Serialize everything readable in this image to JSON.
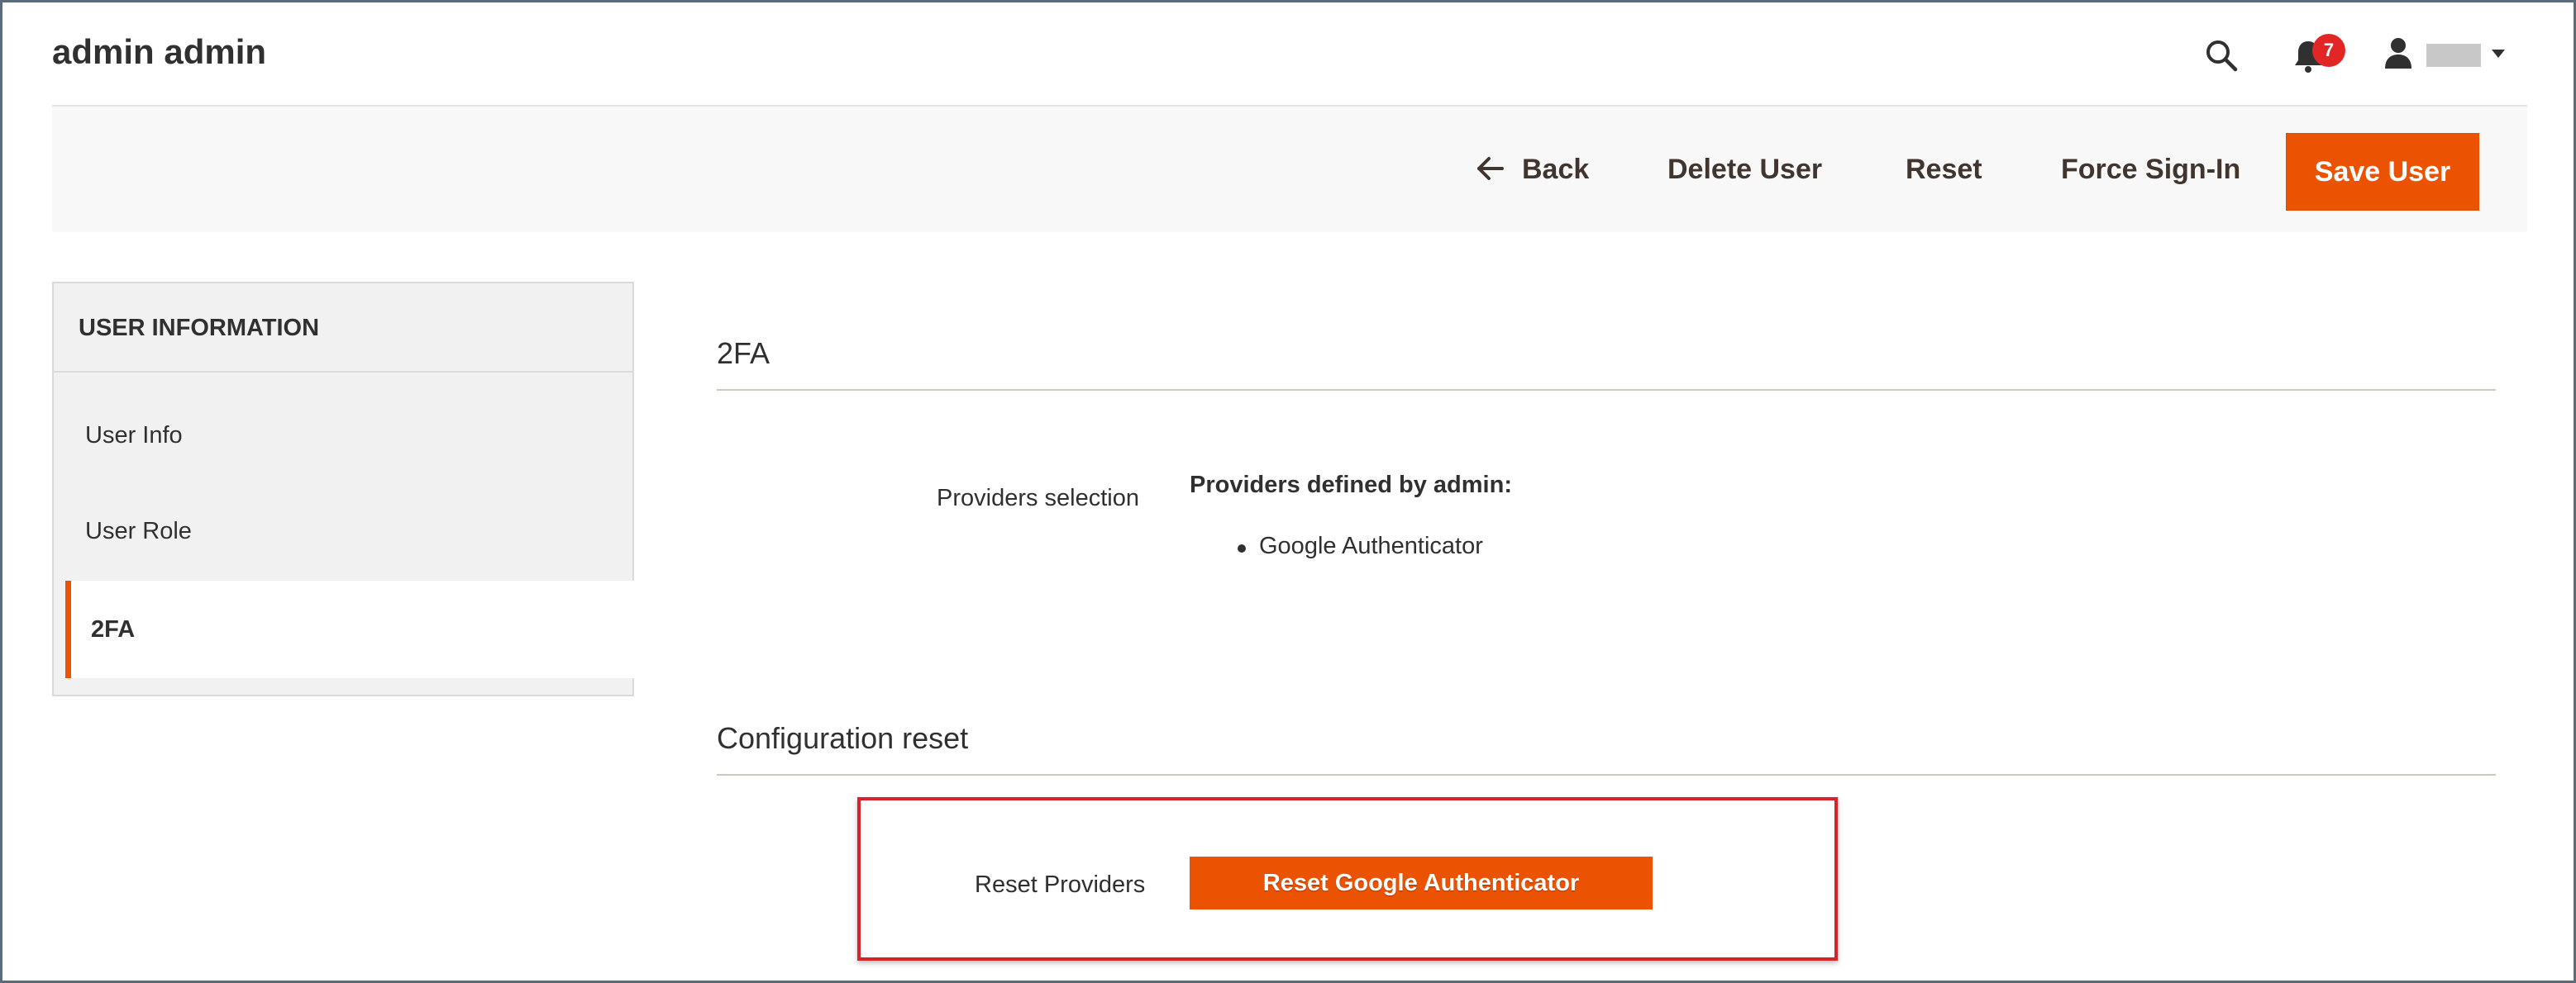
{
  "header": {
    "title": "admin admin",
    "notification_count": "7",
    "icons": [
      "search-icon",
      "bell-icon",
      "user-icon",
      "caret-down-icon"
    ]
  },
  "actions": {
    "back": "Back",
    "delete_user": "Delete User",
    "reset": "Reset",
    "force_signin": "Force Sign-In",
    "save_user": "Save User"
  },
  "sidebar": {
    "heading": "USER INFORMATION",
    "items": [
      {
        "label": "User Info",
        "active": false
      },
      {
        "label": "User Role",
        "active": false
      },
      {
        "label": "2FA",
        "active": true
      }
    ]
  },
  "main": {
    "section_2fa_title": "2FA",
    "providers_label": "Providers selection",
    "providers_heading": "Providers defined by admin:",
    "providers": [
      "Google Authenticator"
    ],
    "section_config_title": "Configuration reset",
    "reset_label": "Reset Providers",
    "reset_button": "Reset Google Authenticator"
  },
  "colors": {
    "accent": "#eb5202",
    "badge": "#e22626",
    "highlight": "#d8232a"
  }
}
